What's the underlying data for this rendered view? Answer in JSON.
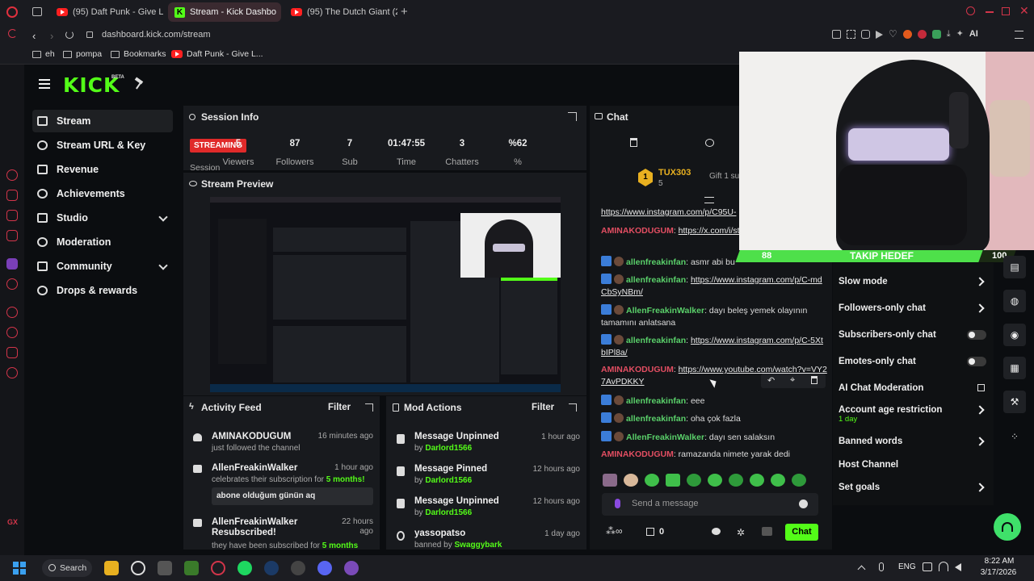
{
  "browser": {
    "tabs": [
      {
        "label": "(95) Daft Punk - Give Life"
      },
      {
        "label": "Stream - Kick Dashbo"
      },
      {
        "label": "(95) The Dutch Giant (2.16"
      }
    ],
    "url": "dashboard.kick.com/stream",
    "ai_label": "AI",
    "bookmarks": [
      {
        "label": "eh"
      },
      {
        "label": "pompa"
      },
      {
        "label": "Bookmarks"
      },
      {
        "label": "Daft Punk - Give L..."
      }
    ]
  },
  "kick": {
    "logo": "KICK",
    "beta": "BETA",
    "nav": [
      {
        "label": "Stream",
        "icon": "broadcast-icon",
        "active": true
      },
      {
        "label": "Stream URL & Key",
        "icon": "link-icon"
      },
      {
        "label": "Revenue",
        "icon": "wallet-icon"
      },
      {
        "label": "Achievements",
        "icon": "trophy-icon"
      },
      {
        "label": "Studio",
        "icon": "studio-icon",
        "expandable": true
      },
      {
        "label": "Moderation",
        "icon": "gavel-icon"
      },
      {
        "label": "Community",
        "icon": "community-icon",
        "expandable": true
      },
      {
        "label": "Drops & rewards",
        "icon": "gift-icon"
      }
    ],
    "session": {
      "title": "Session Info",
      "badge": "STREAMING",
      "badge_sub": "Session",
      "stats": [
        {
          "value": "5",
          "label": "Viewers"
        },
        {
          "value": "87",
          "label": "Followers"
        },
        {
          "value": "7",
          "label": "Sub"
        },
        {
          "value": "01:47:55",
          "label": "Time"
        },
        {
          "value": "3",
          "label": "Chatters"
        },
        {
          "value": "%62",
          "label": "%"
        }
      ]
    },
    "preview": {
      "title": "Stream Preview"
    },
    "activity": {
      "title": "Activity Feed",
      "filter": "Filter",
      "items": [
        {
          "title": "AMINAKODUGUM",
          "sub": "just followed the channel",
          "time": "16 minutes ago",
          "icon": "heart-icon"
        },
        {
          "title": "AllenFreakinWalker",
          "sub_pre": "celebrates their subscription for",
          "sub_num": "5 months!",
          "time": "1 hour ago",
          "quote": "abone olduğum günün aq",
          "icon": "star-icon"
        },
        {
          "title": "AllenFreakinWalker Resubscribed!",
          "sub_pre": "they have been subscribed for",
          "sub_num": "5 months",
          "time": "22 hours ago",
          "icon": "sparkle-icon"
        }
      ]
    },
    "mod": {
      "title": "Mod Actions",
      "filter": "Filter",
      "items": [
        {
          "title": "Message Unpinned",
          "by": "by",
          "user": "Darlord1566",
          "time": "1 hour ago",
          "icon": "unpin-icon"
        },
        {
          "title": "Message Pinned",
          "by": "by",
          "user": "Darlord1566",
          "time": "12 hours ago",
          "icon": "pin-icon"
        },
        {
          "title": "Message Unpinned",
          "by": "by",
          "user": "Darlord1566",
          "time": "12 hours ago",
          "icon": "unpin-icon"
        },
        {
          "title": "yassopatso",
          "by": "banned by",
          "user": "Swaggybark",
          "time": "1 day ago",
          "icon": "ban-icon"
        }
      ]
    },
    "chat": {
      "title": "Chat",
      "pinned_user": "TUX303",
      "pinned_count": "5",
      "gift": "Gift 1 sub",
      "messages": [
        {
          "link": "https://www.instagram.com/p/C95U-"
        },
        {
          "user": "AMINAKODUGUM",
          "color": "red",
          "link": "https://x.com/i/status/20313290200"
        },
        {
          "user": "allenfreakinfan",
          "color": "green",
          "text": "asmr abi bu"
        },
        {
          "user": "allenfreakinfan",
          "color": "green",
          "link": "https://www.instagram.com/p/C-mdCbSyNBm/"
        },
        {
          "user": "AllenFreakinWalker",
          "color": "green",
          "text": "dayı beleş yemek olayının tamamını anlatsana"
        },
        {
          "user": "allenfreakinfan",
          "color": "green",
          "link": "https://www.instagram.com/p/C-5XtbIPl8a/"
        },
        {
          "user": "AMINAKODUGUM",
          "color": "red",
          "link": "https://www.youtube.com/watch?v=VY27AvPDKKY"
        },
        {
          "user": "allenfreakinfan",
          "color": "green",
          "text": "eee"
        },
        {
          "user": "allenfreakinfan",
          "color": "green",
          "text": "oha çok fazla"
        },
        {
          "user": "AllenFreakinWalker",
          "color": "green",
          "text": "dayı sen salaksın"
        },
        {
          "user": "AMINAKODUGUM",
          "color": "red",
          "text": "ramazanda nimete yarak dedi"
        }
      ],
      "placeholder": "Send a message",
      "points": "0",
      "send": "Chat"
    },
    "goal": {
      "current": "88",
      "label": "TAKIP HEDEF",
      "target": "100",
      "progress": 0.88
    },
    "settings": [
      {
        "label": "Slow mode",
        "type": "arrow"
      },
      {
        "label": "Followers-only chat",
        "type": "arrow"
      },
      {
        "label": "Subscribers-only chat",
        "type": "toggle",
        "value": false
      },
      {
        "label": "Emotes-only chat",
        "type": "toggle",
        "value": false
      },
      {
        "label": "AI Chat Moderation",
        "type": "external"
      },
      {
        "label": "Account age restriction",
        "sub": "1 day",
        "type": "arrow"
      },
      {
        "label": "Banned words",
        "type": "arrow"
      },
      {
        "label": "Host Channel",
        "type": "none"
      },
      {
        "label": "Set goals",
        "type": "arrow"
      }
    ]
  },
  "taskbar": {
    "search": "Search",
    "lang": "ENG",
    "time": "8:22 AM",
    "date": "3/17/2026"
  },
  "colors": {
    "kick_green": "#53fc18",
    "live_red": "#e02a2a",
    "opera_red": "#d2354a"
  }
}
